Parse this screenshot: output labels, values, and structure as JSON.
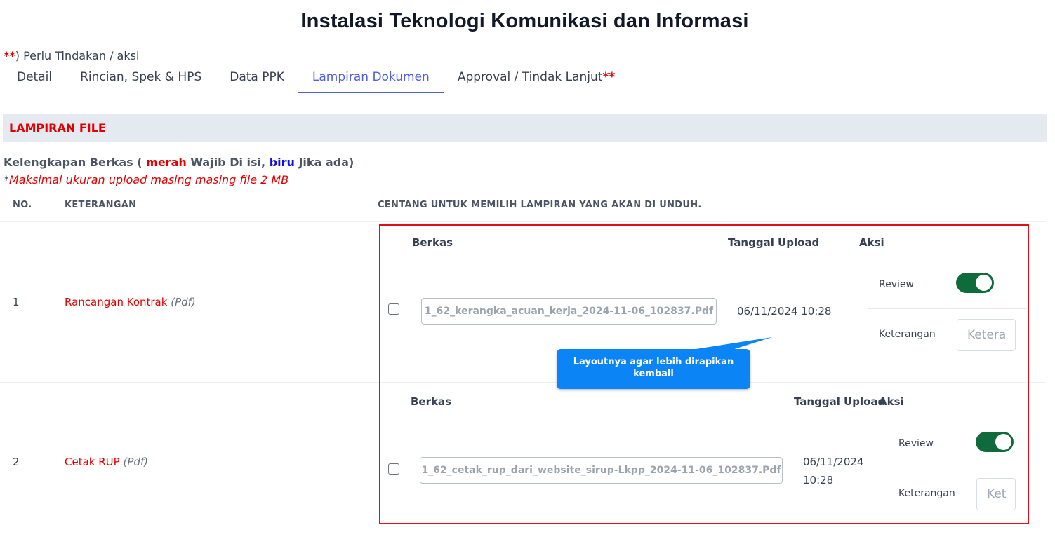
{
  "page": {
    "title": "Instalasi Teknologi Komunikasi dan Informasi"
  },
  "action_note": {
    "stars": "**",
    "text": ") Perlu Tindakan / aksi"
  },
  "tabs": [
    {
      "label": "Detail"
    },
    {
      "label": "Rincian, Spek & HPS"
    },
    {
      "label": "Data PPK"
    },
    {
      "label": "Lampiran Dokumen",
      "active": true
    },
    {
      "label": "Approval / Tindak Lanjut",
      "stars": "**"
    }
  ],
  "section": {
    "title": "LAMPIRAN FILE"
  },
  "kelengkapan": {
    "prefix": "Kelengkapan Berkas ( ",
    "red_word": "merah",
    "mid": " Wajib Di isi, ",
    "blue_word": "biru",
    "suffix": " Jika ada)"
  },
  "max_note": {
    "asterisk": "*",
    "text": "Maksimal ukuran upload masing masing file 2 MB"
  },
  "table": {
    "headers": {
      "no": "NO.",
      "keterangan": "KETERANGAN",
      "centang": "CENTANG UNTUK MEMILIH LAMPIRAN YANG AKAN DI UNDUH."
    },
    "sub_headers": {
      "berkas": "Berkas",
      "tanggal": "Tanggal Upload",
      "aksi": "Aksi"
    },
    "rows": [
      {
        "no": "1",
        "desc": "Rancangan Kontrak",
        "format": "(Pdf)",
        "file": "1_62_kerangka_acuan_kerja_2024-11-06_102837.Pdf",
        "date_line1": "06/11/2024 10:28",
        "date_line2": "",
        "review_label": "Review",
        "review_on": true,
        "ket_label": "Keterangan",
        "ket_placeholder": "Ketera",
        "checked": false
      },
      {
        "no": "2",
        "desc": "Cetak RUP",
        "format": "(Pdf)",
        "file": "1_62_cetak_rup_dari_website_sirup-Lkpp_2024-11-06_102837.Pdf",
        "date_line1": "06/11/2024",
        "date_line2": "10:28",
        "review_label": "Review",
        "review_on": true,
        "ket_label": "Keterangan",
        "ket_placeholder": "Ket",
        "checked": false
      }
    ]
  },
  "callout": {
    "text": "Layoutnya agar lebih dirapikan kembali"
  },
  "colors": {
    "required_red": "#e00000",
    "optional_blue": "#1010dd",
    "tab_active": "#4f5fe0",
    "toggle_on": "#0f6a3c",
    "callout_bg": "#0b84f5",
    "annotation_border": "#e0101a"
  }
}
